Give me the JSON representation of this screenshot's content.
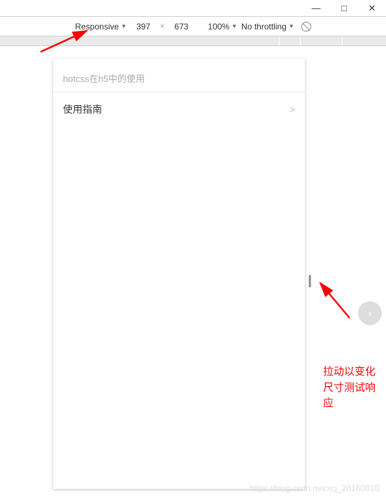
{
  "window": {
    "minimize": "—",
    "maximize": "□",
    "close": "✕"
  },
  "toolbar": {
    "device_mode": "Responsive",
    "width": "397",
    "height": "673",
    "zoom": "100%",
    "throttling": "No throttling"
  },
  "page": {
    "header_text": "hotcss在h5中的使用",
    "menu": {
      "label": "使用指南",
      "chevron": ">"
    }
  },
  "annotation": {
    "text": "拉动以变化尺寸测试响应"
  },
  "watermark": "https://blog.csdn.net/xcj_20160810"
}
